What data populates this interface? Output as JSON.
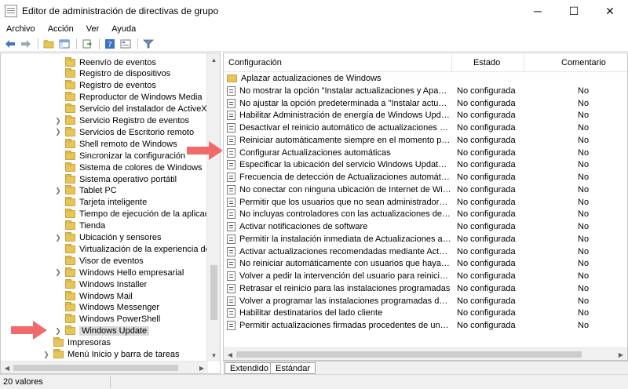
{
  "window": {
    "title": "Editor de administración de directivas de grupo",
    "controls": {
      "minimize": "─",
      "maximize": "☐",
      "close": "✕"
    }
  },
  "menu": [
    "Archivo",
    "Acción",
    "Ver",
    "Ayuda"
  ],
  "tree": [
    {
      "label": "Reenvío de eventos",
      "expandable": false,
      "level": 2
    },
    {
      "label": "Registro de dispositivos",
      "expandable": false,
      "level": 2
    },
    {
      "label": "Registro de eventos",
      "expandable": false,
      "level": 2
    },
    {
      "label": "Reproductor de Windows Media",
      "expandable": false,
      "level": 2
    },
    {
      "label": "Servicio del instalador de ActiveX",
      "expandable": false,
      "level": 2
    },
    {
      "label": "Servicio Registro de eventos",
      "expandable": true,
      "level": 2
    },
    {
      "label": "Servicios de Escritorio remoto",
      "expandable": true,
      "level": 2
    },
    {
      "label": "Shell remoto de Windows",
      "expandable": false,
      "level": 2
    },
    {
      "label": "Sincronizar la configuración",
      "expandable": false,
      "level": 2
    },
    {
      "label": "Sistema de colores de Windows",
      "expandable": false,
      "level": 2
    },
    {
      "label": "Sistema operativo portátil",
      "expandable": false,
      "level": 2
    },
    {
      "label": "Tablet PC",
      "expandable": true,
      "level": 2
    },
    {
      "label": "Tarjeta inteligente",
      "expandable": false,
      "level": 2
    },
    {
      "label": "Tiempo de ejecución de la aplicación",
      "expandable": false,
      "level": 2
    },
    {
      "label": "Tienda",
      "expandable": false,
      "level": 2
    },
    {
      "label": "Ubicación y sensores",
      "expandable": true,
      "level": 2
    },
    {
      "label": "Virtualización de la experiencia del usu",
      "expandable": false,
      "level": 2
    },
    {
      "label": "Visor de eventos",
      "expandable": false,
      "level": 2
    },
    {
      "label": "Windows Hello empresarial",
      "expandable": true,
      "level": 2
    },
    {
      "label": "Windows Installer",
      "expandable": false,
      "level": 2
    },
    {
      "label": "Windows Mail",
      "expandable": false,
      "level": 2
    },
    {
      "label": "Windows Messenger",
      "expandable": false,
      "level": 2
    },
    {
      "label": "Windows PowerShell",
      "expandable": false,
      "level": 2
    },
    {
      "label": "Windows Update",
      "expandable": true,
      "level": 2,
      "selected": true
    },
    {
      "label": "Impresoras",
      "expandable": false,
      "level": 1
    },
    {
      "label": "Menú Inicio y barra de tareas",
      "expandable": true,
      "level": 1
    }
  ],
  "list": {
    "headers": {
      "config": "Configuración",
      "state": "Estado",
      "comment": "Comentario"
    },
    "folder_row": "Aplazar actualizaciones de Windows",
    "rows": [
      {
        "name": "No mostrar la opción \"Instalar actualizaciones y Apagar\" en ...",
        "state": "No configurada",
        "comment": "No"
      },
      {
        "name": "No ajustar la opción predeterminada a \"Instalar actualizacio...",
        "state": "No configurada",
        "comment": "No"
      },
      {
        "name": "Habilitar Administración de energía de Windows Update par...",
        "state": "No configurada",
        "comment": "No"
      },
      {
        "name": "Desactivar el reinicio automático de actualizaciones durante...",
        "state": "No configurada",
        "comment": "No"
      },
      {
        "name": "Reiniciar automáticamente siempre en el momento progra...",
        "state": "No configurada",
        "comment": "No"
      },
      {
        "name": "Configurar Actualizaciones automáticas",
        "state": "No configurada",
        "comment": "No"
      },
      {
        "name": "Especificar la ubicación del servicio Windows Update en la i...",
        "state": "No configurada",
        "comment": "No"
      },
      {
        "name": "Frecuencia de detección de Actualizaciones automáticas",
        "state": "No configurada",
        "comment": "No"
      },
      {
        "name": "No conectar con ninguna ubicación de Internet de Window...",
        "state": "No configurada",
        "comment": "No"
      },
      {
        "name": "Permitir que los usuarios que no sean administradores recib...",
        "state": "No configurada",
        "comment": "No"
      },
      {
        "name": "No incluyas controladores con las actualizaciones de Windo...",
        "state": "No configurada",
        "comment": "No"
      },
      {
        "name": "Activar notificaciones de software",
        "state": "No configurada",
        "comment": "No"
      },
      {
        "name": "Permitir la instalación inmediata de Actualizaciones automá...",
        "state": "No configurada",
        "comment": "No"
      },
      {
        "name": "Activar actualizaciones recomendadas mediante Actualizaci...",
        "state": "No configurada",
        "comment": "No"
      },
      {
        "name": "No reiniciar automáticamente con usuarios que hayan inicia...",
        "state": "No configurada",
        "comment": "No"
      },
      {
        "name": "Volver a pedir la intervención del usuario para reiniciar con i...",
        "state": "No configurada",
        "comment": "No"
      },
      {
        "name": "Retrasar el reinicio para las instalaciones programadas",
        "state": "No configurada",
        "comment": "No"
      },
      {
        "name": "Volver a programar las instalaciones programadas de Actuali...",
        "state": "No configurada",
        "comment": "No"
      },
      {
        "name": "Habilitar destinatarios del lado cliente",
        "state": "No configurada",
        "comment": "No"
      },
      {
        "name": "Permitir actualizaciones firmadas procedentes de una ubica...",
        "state": "No configurada",
        "comment": "No"
      }
    ]
  },
  "tabs": [
    "Extendido",
    "Estándar"
  ],
  "status": "20 valores",
  "colors": {
    "arrow": "#f06a6a",
    "folder": "#e8c55a",
    "selected_bg": "#d9d9d9"
  }
}
